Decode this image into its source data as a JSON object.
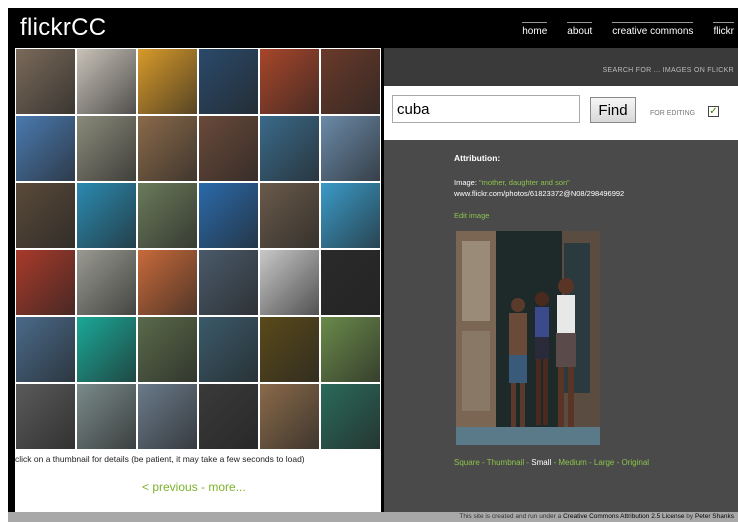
{
  "app": {
    "logo": "flickrCC"
  },
  "nav": {
    "items": [
      "home",
      "about",
      "creative commons",
      "flickr"
    ]
  },
  "thumbnails": [
    "#7a6a5a",
    "#c8c2b8",
    "#d89a2a",
    "#2a4a6a",
    "#a8462a",
    "#6a3a2a",
    "#4a7ab0",
    "#8a8a7a",
    "#8a6a4a",
    "#6a4a3a",
    "#3a6a8a",
    "#6a8aa8",
    "#5a4a3a",
    "#2a8ab0",
    "#6a7a5a",
    "#2a6aaa",
    "#6a5a4a",
    "#3a9ac8",
    "#a83a2a",
    "#9a9a92",
    "#c86a3a",
    "#4a5a6a",
    "#c8c8c8",
    "#2a2a2a",
    "#4a6a8a",
    "#1aa898",
    "#5a6a4a",
    "#3a5a6a",
    "#5a4a1a",
    "#6a8a4a",
    "#5a5a5a",
    "#7a8a8a",
    "#6a7a8a",
    "#3a3a3a",
    "#8a6a4a",
    "#2a6a5a"
  ],
  "grid_hint": "click on a thumbnail for details (be patient, it may take a few seconds to load)",
  "pager": {
    "previous": "< previous",
    "separator": " - ",
    "more": "more..."
  },
  "search": {
    "header_label": "SEARCH FOR ... IMAGES ON FLICKR",
    "query": "cuba",
    "find_label": "Find",
    "for_editing_label": "FOR EDITING",
    "for_editing_checked": true
  },
  "attribution": {
    "title": "Attribution:",
    "image_prefix": "Image: ",
    "image_title": "\"mother, daughter and son\"",
    "url": "www.flickr.com/photos/61823372@N08/298496992",
    "edit_link": "Edit image"
  },
  "sizes": {
    "items": [
      "Square",
      "Thumbnail",
      "Small",
      "Medium",
      "Large",
      "Original"
    ],
    "separator": " - ",
    "current": "Small"
  },
  "footer": {
    "prefix": "This site is created and run under a",
    "license": "Creative Commons Attribution 2.5 License",
    "by": "by",
    "author": "Peter Shanks"
  },
  "colors": {
    "accent_green": "#8bc34a",
    "panel_dark": "#4a4a4a",
    "topbar": "#000000"
  }
}
